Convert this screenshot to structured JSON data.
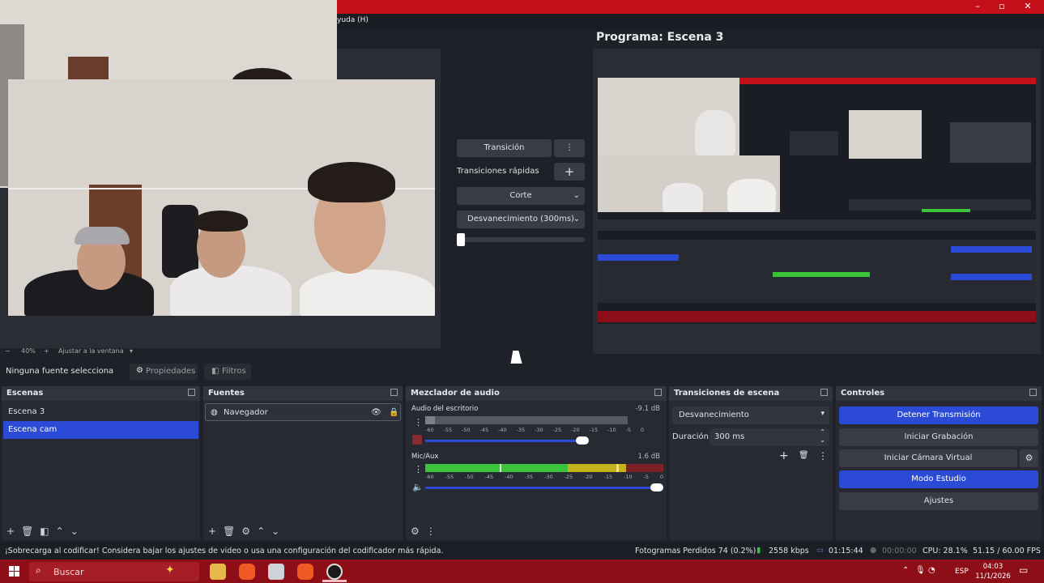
{
  "menu": {
    "help": "yuda (H)"
  },
  "program": {
    "title": "Programa: Escena 3"
  },
  "preview": {
    "zoom": "40%",
    "fit": "Ajustar a la ventana"
  },
  "transition_controls": {
    "transition_label": "Transición",
    "quick_transitions_label": "Transiciones rápidas",
    "cut_label": "Corte",
    "fade_label": "Desvanecimiento (300ms)"
  },
  "source_bar": {
    "no_source": "Ninguna fuente selecciona",
    "properties": "Propiedades",
    "filters": "Filtros"
  },
  "scenes": {
    "title": "Escenas",
    "items": [
      "Escena 3",
      "Escena cam"
    ],
    "selected": 1
  },
  "sources": {
    "title": "Fuentes",
    "items": [
      "Navegador"
    ]
  },
  "mixer": {
    "title": "Mezclador de audio",
    "channels": [
      {
        "name": "Audio del escritorio",
        "db": "-9.1 dB",
        "level": 0.0,
        "volume": 0.88
      },
      {
        "name": "Mic/Aux",
        "db": "1.6 dB",
        "level": 0.84,
        "volume": 1.0
      }
    ],
    "ticks": [
      "-60",
      "-55",
      "-50",
      "-45",
      "-40",
      "-35",
      "-30",
      "-25",
      "-20",
      "-15",
      "-10",
      "-5",
      "0"
    ]
  },
  "scene_transitions": {
    "title": "Transiciones de escena",
    "selected": "Desvanecimiento",
    "duration_label": "Duración",
    "duration": "300 ms"
  },
  "controls": {
    "title": "Controles",
    "stop_stream": "Detener Transmisión",
    "start_recording": "Iniciar Grabación",
    "virtual_camera": "Iniciar Cámara Virtual",
    "studio_mode": "Modo Estudio",
    "settings": "Ajustes"
  },
  "statusbar": {
    "message": "¡Sobrecarga al codificar! Considera bajar los ajustes de video o usa una configuración del codificador más rápida.",
    "dropped_frames": "Fotogramas Perdidos 74 (0.2%)",
    "bitrate": "2558 kbps",
    "stream_time": "01:15:44",
    "rec_time": "00:00:00",
    "cpu": "CPU: 28.1%",
    "fps": "51.15 / 60.00 FPS"
  },
  "taskbar": {
    "search": "Buscar",
    "lang": "ESP",
    "time": "04:03",
    "date": "11/1/2026"
  },
  "colors": {
    "accent": "#2b4bd6",
    "title_red": "#c40f1a",
    "taskbar": "#8e0e17",
    "meter_green": "#39c43a",
    "meter_yellow": "#c6b21c",
    "meter_red": "#c22a2a"
  }
}
